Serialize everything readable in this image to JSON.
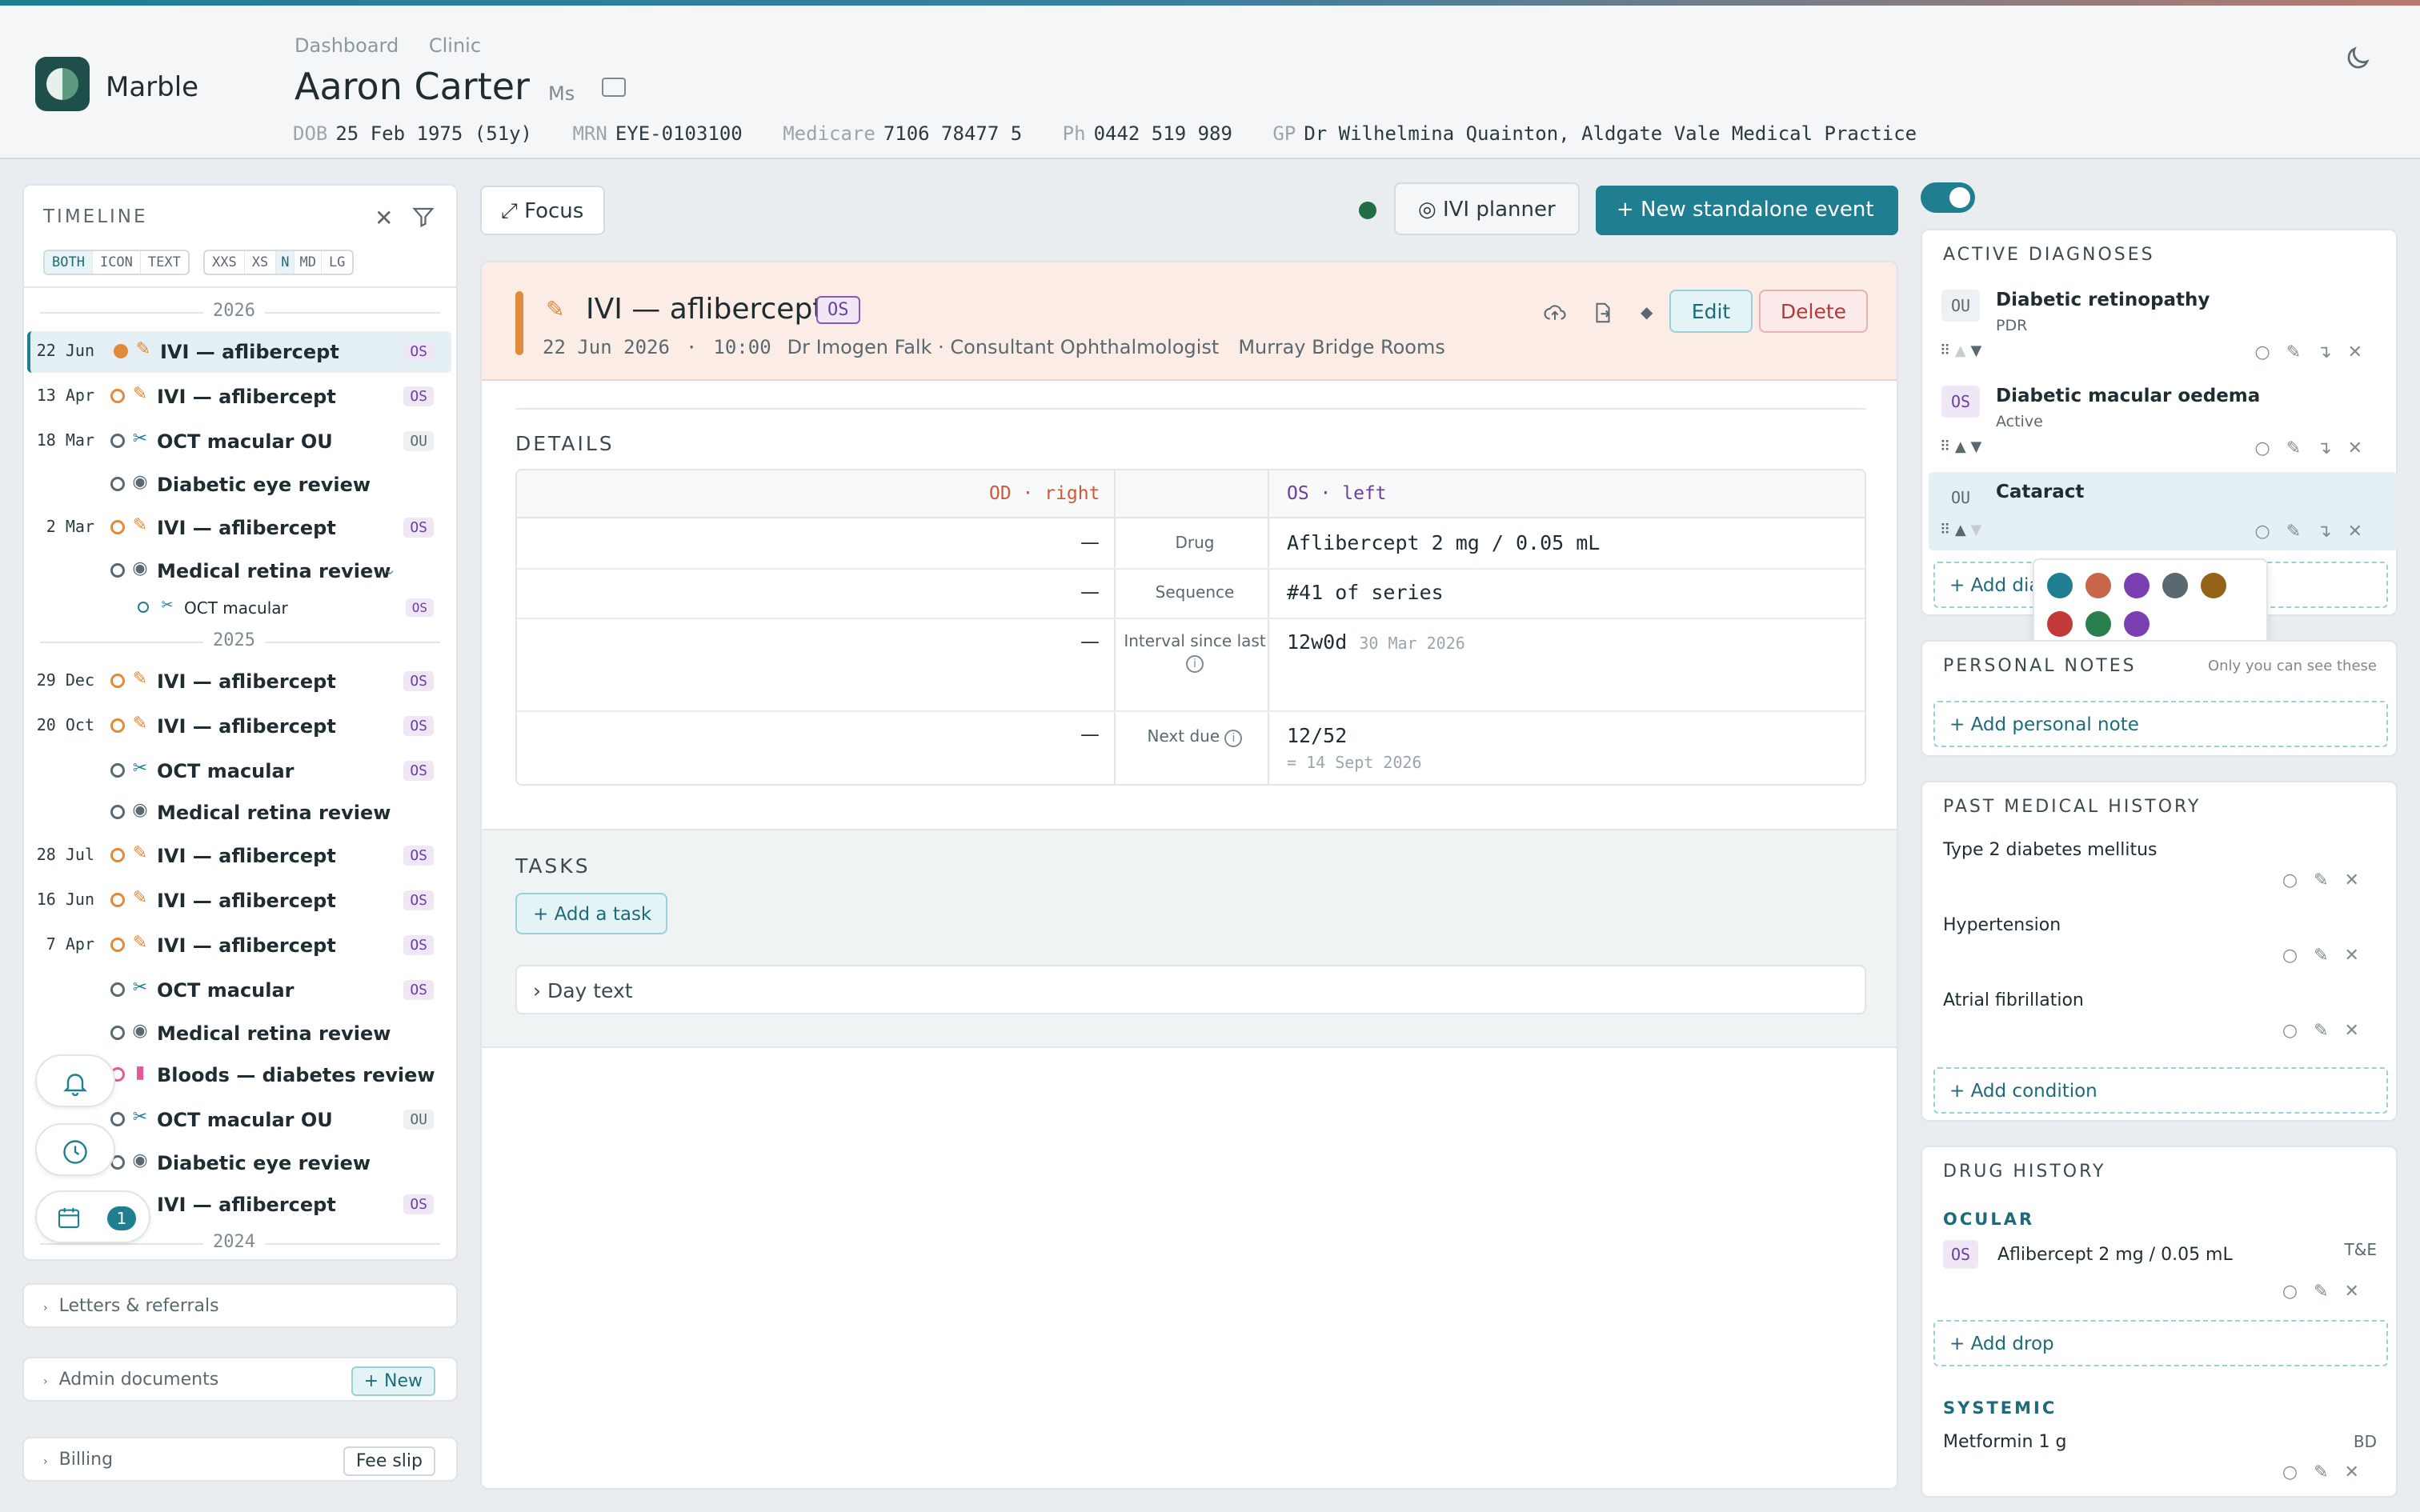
{
  "header": {
    "brand": "Marble",
    "breadcrumbs": [
      "Dashboard",
      "Clinic"
    ],
    "patient_name": "Aaron Carter",
    "patient_title": "Ms",
    "demographics": [
      {
        "label": "DOB",
        "value": "25 Feb 1975 (51y)"
      },
      {
        "label": "MRN",
        "value": "EYE-0103100"
      },
      {
        "label": "Medicare",
        "value": "7106 78477 5"
      },
      {
        "label": "Ph",
        "value": "0442 519 989"
      },
      {
        "label": "GP",
        "value": "Dr Wilhelmina Quainton, Aldgate Vale Medical Practice"
      }
    ]
  },
  "timeline": {
    "title": "TIMELINE",
    "mode_options": [
      "BOTH",
      "ICON",
      "TEXT"
    ],
    "mode_selected": "BOTH",
    "size_options": [
      "XXS",
      "XS",
      "N",
      "MD",
      "LG"
    ],
    "size_selected": "N",
    "years": [
      "2026",
      "2025",
      "2024"
    ],
    "items": [
      {
        "date": "22 Jun",
        "title": "IVI — aflibercept",
        "eye": "OS"
      },
      {
        "date": "13 Apr",
        "title": "IVI — aflibercept",
        "eye": "OS"
      },
      {
        "date": "18 Mar",
        "title": "OCT macular OU",
        "eye": "OU"
      },
      {
        "date": "",
        "title": "Diabetic eye review",
        "eye": ""
      },
      {
        "date": "2 Mar",
        "title": "IVI — aflibercept",
        "eye": "OS"
      },
      {
        "date": "",
        "title": "Medical retina review",
        "eye": ""
      },
      {
        "date": "",
        "title": "OCT macular",
        "eye": "OS"
      },
      {
        "date": "29 Dec",
        "title": "IVI — aflibercept",
        "eye": "OS"
      },
      {
        "date": "20 Oct",
        "title": "IVI — aflibercept",
        "eye": "OS"
      },
      {
        "date": "",
        "title": "OCT macular",
        "eye": "OS"
      },
      {
        "date": "",
        "title": "Medical retina review",
        "eye": ""
      },
      {
        "date": "28 Jul",
        "title": "IVI — aflibercept",
        "eye": "OS"
      },
      {
        "date": "16 Jun",
        "title": "IVI — aflibercept",
        "eye": "OS"
      },
      {
        "date": "7 Apr",
        "title": "IVI — aflibercept",
        "eye": "OS"
      },
      {
        "date": "",
        "title": "OCT macular",
        "eye": "OS"
      },
      {
        "date": "",
        "title": "Medical retina review",
        "eye": ""
      },
      {
        "date": "",
        "title": "Bloods — diabetes review",
        "eye": ""
      },
      {
        "date": "",
        "title": "OCT macular OU",
        "eye": "OU"
      },
      {
        "date": "",
        "title": "Diabetic eye review",
        "eye": ""
      },
      {
        "date": "",
        "title": "IVI — aflibercept",
        "eye": "OS"
      }
    ],
    "notification_count": "1"
  },
  "left_sections": {
    "letters": "Letters & referrals",
    "admin": "Admin documents",
    "admin_button": "+ New",
    "billing": "Billing",
    "billing_button": "Fee slip"
  },
  "toolbar": {
    "focus": "⤢ Focus",
    "ivi_planner": "◎ IVI planner",
    "new_event": "+ New standalone event"
  },
  "event": {
    "title": "IVI — aflibercept",
    "eye": "OS",
    "date": "22 Jun 2026",
    "time": "10:00",
    "clinician": "Dr Imogen Falk · Consultant Ophthalmologist",
    "location": "Murray Bridge Rooms",
    "edit": "Edit",
    "delete": "Delete"
  },
  "details": {
    "heading": "DETAILS",
    "od_header": "OD · right",
    "os_header": "OS · left",
    "rows": [
      {
        "label": "Drug",
        "od": "—",
        "os": "Aflibercept 2 mg / 0.05 mL",
        "os_sub": ""
      },
      {
        "label": "Sequence",
        "od": "—",
        "os": "#41 of series",
        "os_sub": ""
      },
      {
        "label": "Interval since last",
        "od": "—",
        "os": "12w0d",
        "os_sub": "30 Mar 2026"
      },
      {
        "label": "Next due",
        "od": "—",
        "os": "12/52",
        "os_sub": "= 14 Sept 2026"
      }
    ]
  },
  "tasks": {
    "heading": "TASKS",
    "add": "+ Add a task",
    "day_text": "› Day text"
  },
  "active_diagnoses": {
    "heading": "ACTIVE DIAGNOSES",
    "items": [
      {
        "eye": "OU",
        "name": "Diabetic retinopathy",
        "status": "PDR"
      },
      {
        "eye": "OS",
        "name": "Diabetic macular oedema",
        "status": "Active"
      },
      {
        "eye": "OU",
        "name": "Cataract",
        "status": ""
      }
    ],
    "add": "+ Add dia",
    "palette": [
      "#1f7f91",
      "#c8664a",
      "#7a3fb0",
      "#5a6870",
      "#946318",
      "#c23a3a",
      "#2a7f4e",
      "#7a3fb0"
    ]
  },
  "personal_notes": {
    "heading": "PERSONAL NOTES",
    "hint": "Only you can see these",
    "add": "+ Add personal note"
  },
  "past_history": {
    "heading": "PAST MEDICAL HISTORY",
    "items": [
      "Type 2 diabetes mellitus",
      "Hypertension",
      "Atrial fibrillation"
    ],
    "add": "+ Add condition"
  },
  "drug_history": {
    "heading": "DRUG HISTORY",
    "ocular_label": "OCULAR",
    "ocular": [
      {
        "eye": "OS",
        "name": "Aflibercept 2 mg / 0.05 mL",
        "freq": "T&E"
      }
    ],
    "add_drop": "+ Add drop",
    "systemic_label": "SYSTEMIC",
    "systemic": [
      {
        "name": "Metformin 1 g",
        "freq": "BD"
      }
    ]
  }
}
